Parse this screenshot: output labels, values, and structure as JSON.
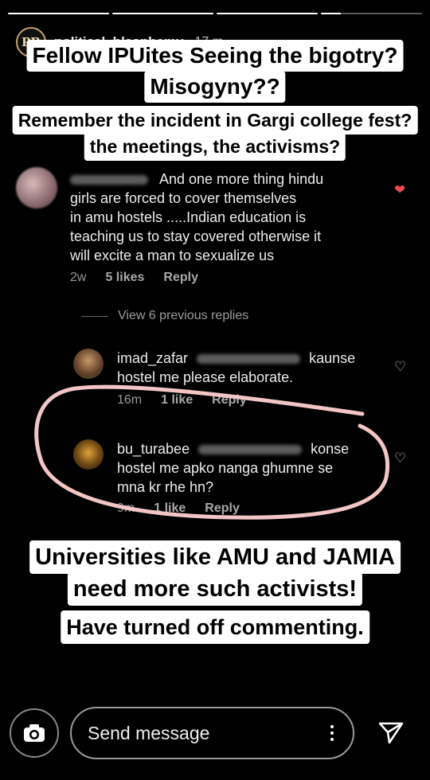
{
  "progress": [
    1,
    1,
    1,
    0.2
  ],
  "header": {
    "account": "political_blasphemy",
    "time": "17 m",
    "avatar_text": "PB"
  },
  "captions": {
    "line1": "Fellow IPUites Seeing the bigotry?",
    "line2": "Misogyny??",
    "line3": "Remember the incident in Gargi college fest?",
    "line4": "the meetings, the activisms?",
    "line5": "Universities like AMU and JAMIA",
    "line6": "need more such activists!",
    "line7": "Have turned off commenting."
  },
  "comment": {
    "lines": [
      "And one more thing hindu",
      "girls are forced to cover themselves",
      "in amu hostels .....Indian education is",
      "teaching us to stay covered otherwise it",
      "will excite a man to sexualize us"
    ],
    "time": "2w",
    "likes": "5 likes",
    "reply": "Reply"
  },
  "view_previous": "View 6 previous replies",
  "replies": [
    {
      "username": "imad_zafar",
      "tail": "kaunse",
      "text": "hostel me please elaborate.",
      "time": "16m",
      "likes": "1 like",
      "reply": "Reply"
    },
    {
      "username": "bu_turabee",
      "tail": "konse",
      "text1": "hostel me apko nanga ghumne se",
      "text2": "mna kr rhe hn?",
      "time": "9m",
      "likes": "1 like",
      "reply": "Reply"
    }
  ],
  "bottom": {
    "placeholder": "Send message"
  },
  "colors": {
    "heart": "#ed4956",
    "annotation": "#f3c6c6",
    "caption_bg": "#ffffff"
  }
}
